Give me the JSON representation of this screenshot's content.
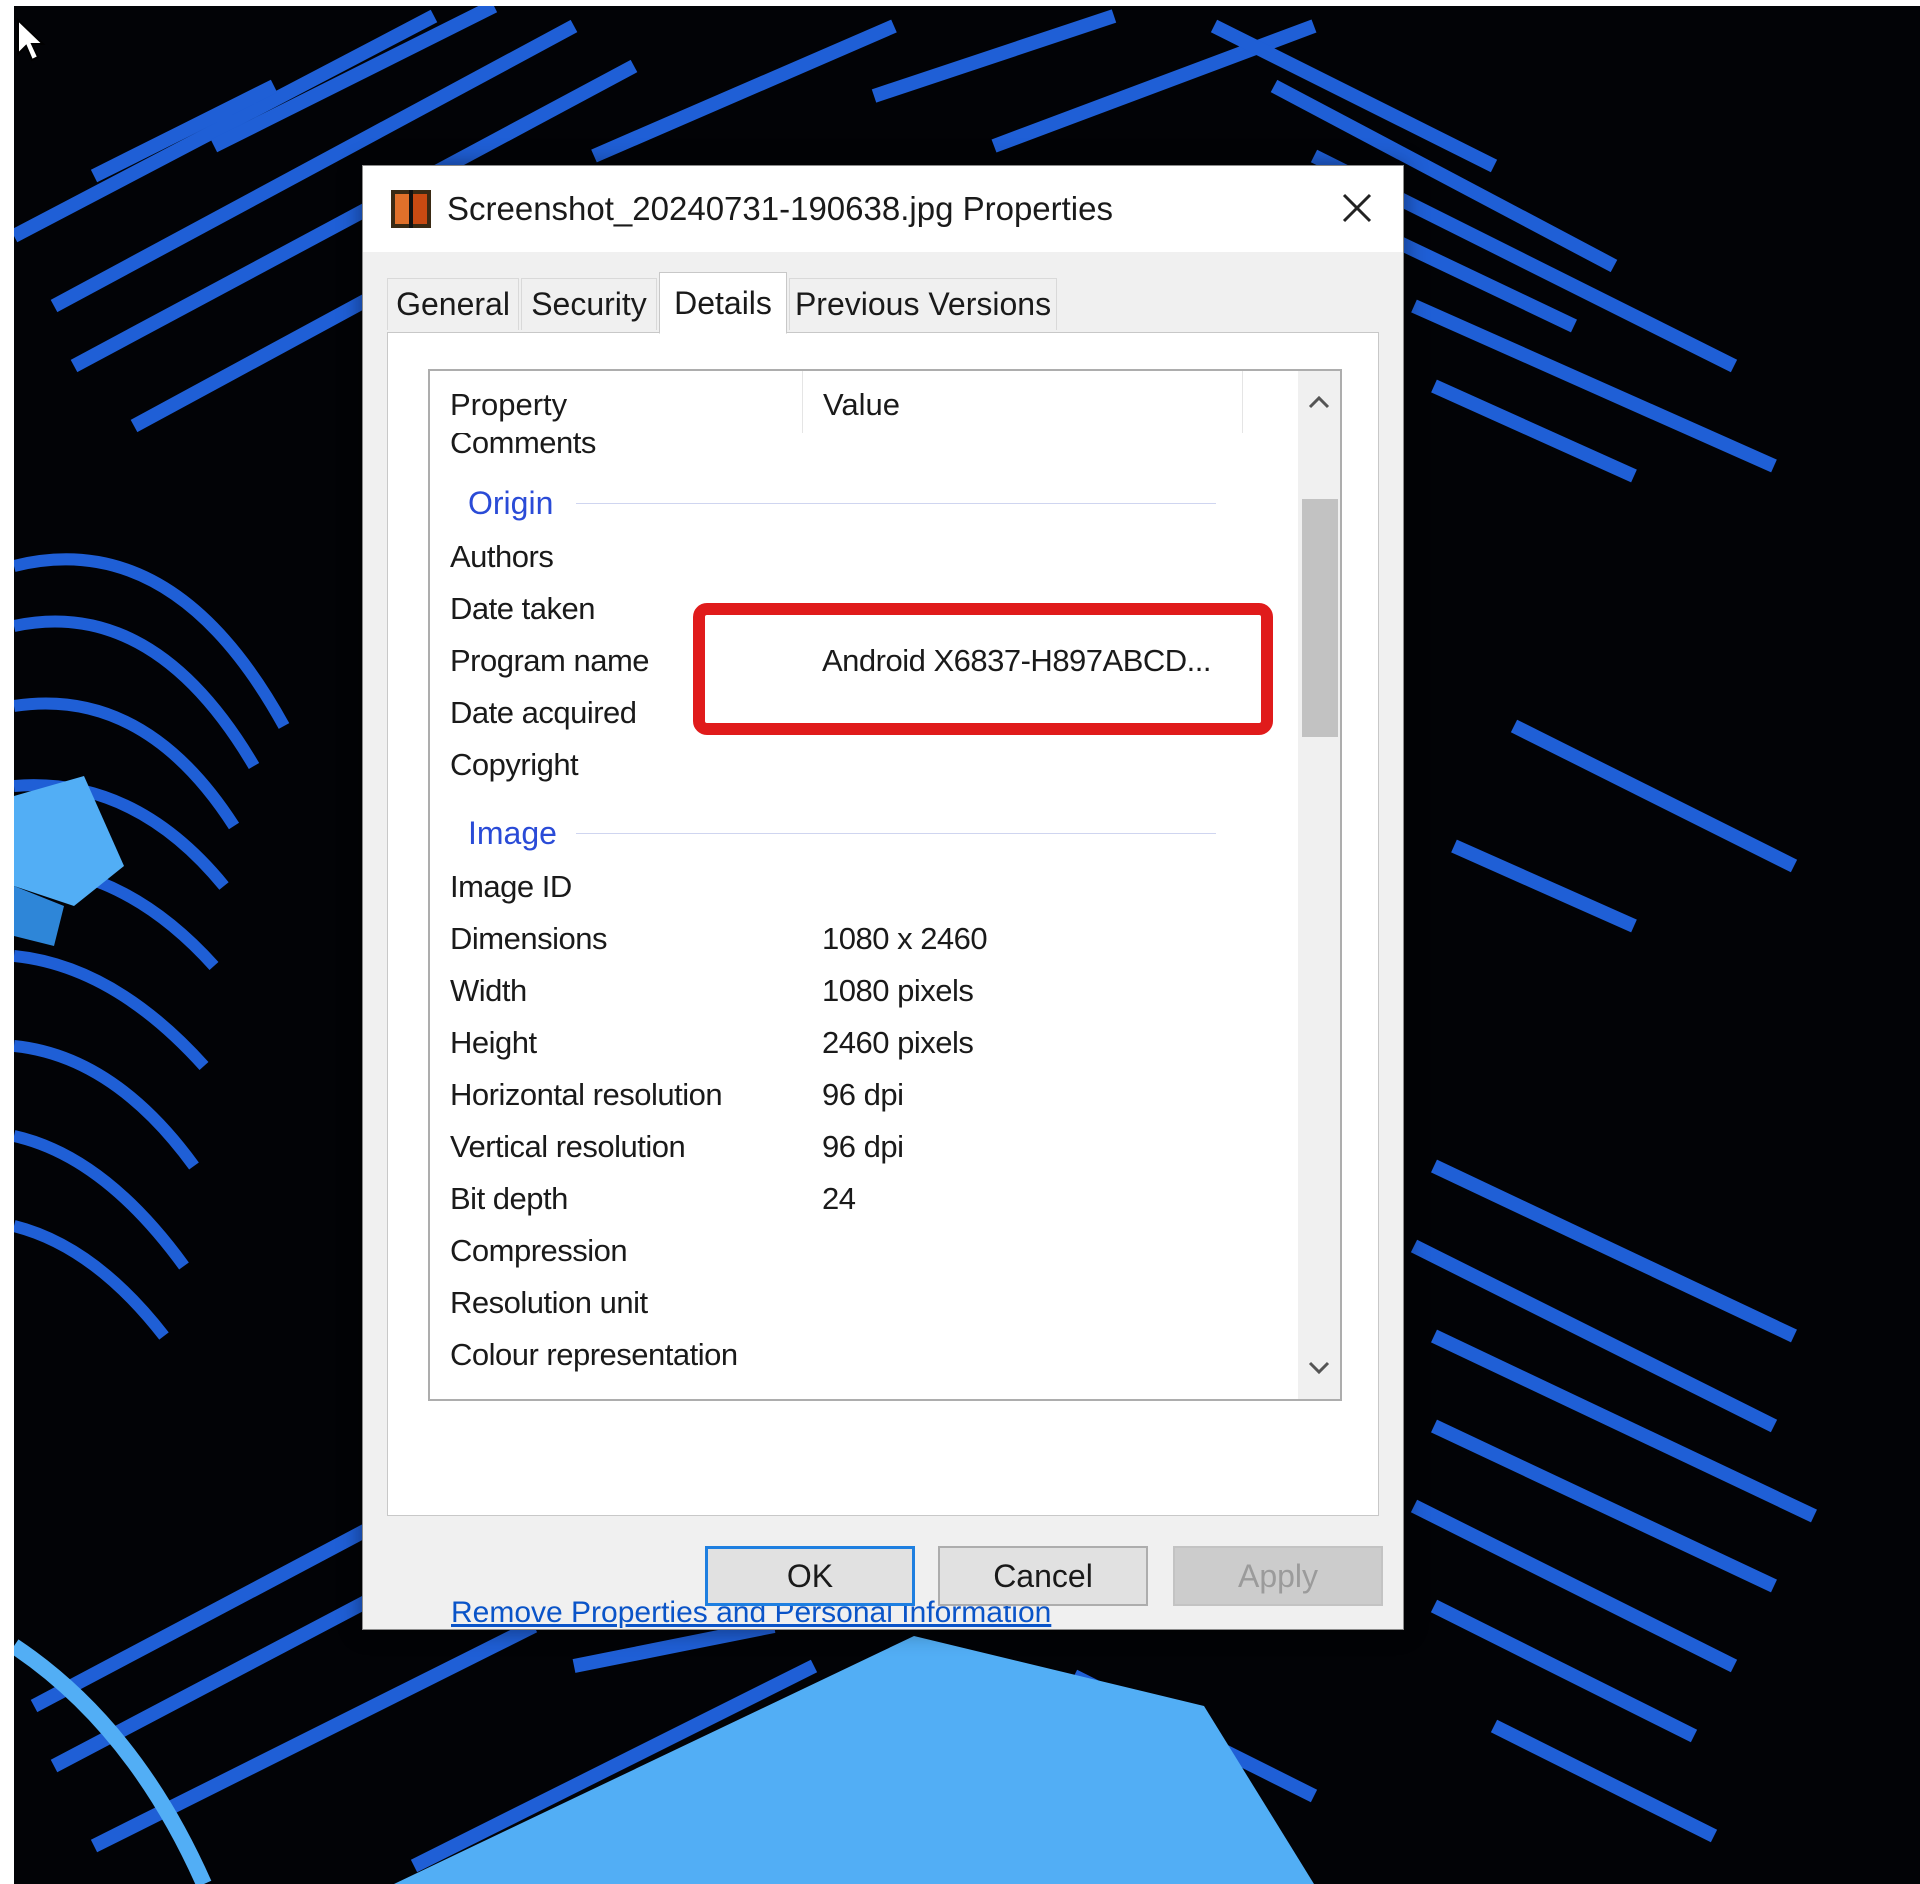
{
  "dialog": {
    "title": "Screenshot_20240731-190638.jpg Properties",
    "tabs": [
      {
        "label": "General"
      },
      {
        "label": "Security"
      },
      {
        "label": "Details"
      },
      {
        "label": "Previous Versions"
      }
    ],
    "active_tab": "Details",
    "list": {
      "header_property": "Property",
      "header_value": "Value",
      "cut_off_row": "Comments",
      "group_origin": "Origin",
      "origin_rows": [
        {
          "property": "Authors",
          "value": ""
        },
        {
          "property": "Date taken",
          "value": ""
        },
        {
          "property": "Program name",
          "value": "Android X6837-H897ABCD..."
        },
        {
          "property": "Date acquired",
          "value": ""
        },
        {
          "property": "Copyright",
          "value": ""
        }
      ],
      "group_image": "Image",
      "image_rows": [
        {
          "property": "Image ID",
          "value": ""
        },
        {
          "property": "Dimensions",
          "value": "1080 x 2460"
        },
        {
          "property": "Width",
          "value": "1080 pixels"
        },
        {
          "property": "Height",
          "value": "2460 pixels"
        },
        {
          "property": "Horizontal resolution",
          "value": "96 dpi"
        },
        {
          "property": "Vertical resolution",
          "value": "96 dpi"
        },
        {
          "property": "Bit depth",
          "value": "24"
        },
        {
          "property": "Compression",
          "value": ""
        },
        {
          "property": "Resolution unit",
          "value": ""
        },
        {
          "property": "Colour representation",
          "value": ""
        }
      ]
    },
    "remove_link": "Remove Properties and Personal Information",
    "buttons": {
      "ok": "OK",
      "cancel": "Cancel",
      "apply": "Apply"
    }
  },
  "colors": {
    "highlight": "#e01b1b",
    "group_header": "#2a4bd7",
    "link": "#0a54c8",
    "wallpaper_stripes": "#1f5fd6",
    "wallpaper_light": "#52aef5"
  }
}
